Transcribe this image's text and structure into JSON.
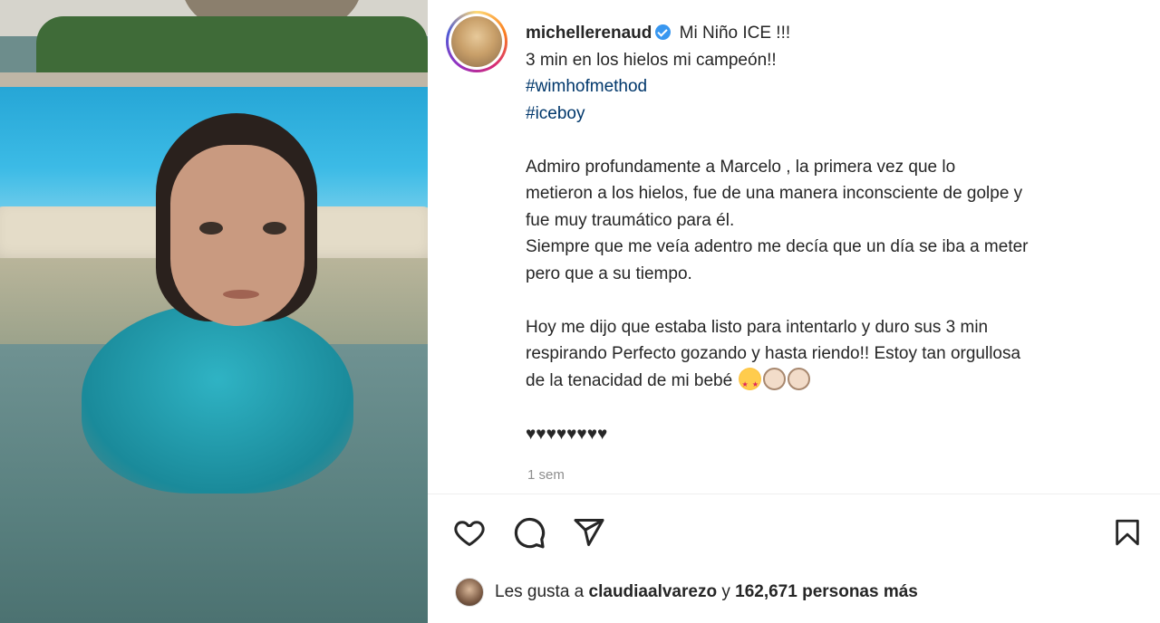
{
  "post": {
    "username": "michellerenaud",
    "caption_title": "Mi Niño ICE !!!",
    "caption_lines": [
      "3 min en los hielos mi campeón!!"
    ],
    "hashtags": [
      "#wimhofmethod",
      "#iceboy"
    ],
    "paragraph1": [
      "Admiro profundamente a Marcelo , la primera vez que lo",
      "metieron a los hielos, fue de una manera inconsciente de golpe y",
      "fue muy traumático para él.",
      "Siempre que me veía adentro me decía que un día se iba a meter",
      "pero que a su tiempo."
    ],
    "paragraph2": [
      "Hoy me dijo que estaba listo para intentarlo y duro sus 3 min",
      "respirando Perfecto gozando y hasta riendo!! Estoy tan orgullosa",
      "de la tenacidad de mi bebé"
    ],
    "emojis": [
      "star-struck-emoji",
      "clapping-hands-emoji",
      "clapping-hands-emoji"
    ],
    "hearts": "♥♥♥♥♥♥♥♥",
    "timestamp": "1 sem"
  },
  "likes": {
    "prefix": "Les gusta a",
    "user": "claudiaalvarezo",
    "connector": "y",
    "count_text": "162,671 personas más"
  },
  "colors": {
    "text": "#262626",
    "hashtag": "#00376b",
    "muted": "#8e8e8e",
    "verified": "#3897f0"
  },
  "icons": [
    "heart-icon",
    "comment-icon",
    "share-icon",
    "bookmark-icon",
    "verified-badge-icon"
  ]
}
